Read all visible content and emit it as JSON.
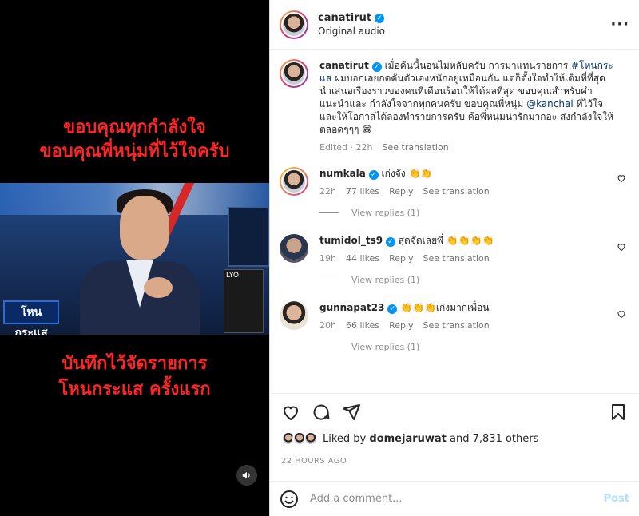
{
  "media": {
    "caption_top": [
      "ขอบคุณทุกกำลังใจ",
      "ขอบคุณพี่หนุ่มที่ไว้ใจครับ"
    ],
    "caption_bottom": [
      "บันทึกไว้จัดรายการ",
      "โหนกระแส ครั้งแรก"
    ],
    "show_logo_text": "โหน กระแส",
    "ad_text": "LYO"
  },
  "header": {
    "username": "canatirut",
    "subtitle": "Original audio"
  },
  "caption": {
    "username": "canatirut",
    "text_1": "เมื่อคืนนี้นอนไม่หลับครับ การมาแทนรายการ ",
    "hashtag": "#โหนกระแส",
    "text_2": " ผมบอกเลยกดดันตัวเองหนักอยู่เหมือนกัน แต่ก็ตั้งใจทำให้เต็มที่ที่สุด นำเสนอเรื่องราวของคนที่เดือนร้อนให้ได้ผลที่สุด ขอบคุณสำหรับคำแนะนำและ กำลังใจจากทุกคนครับ ขอบคุณพี่หนุ่ม ",
    "mention": "@kanchai",
    "text_3": " ที่ไว้ใจและให้โอกาสได้ลองทำรายการครับ คือพี่หนุ่มน่ารักมากอะ ส่งกำลังใจให้ตลอดๆๆๆ 😁",
    "edited": "Edited · 22h",
    "see_translation": "See translation"
  },
  "comments": [
    {
      "username": "numkala",
      "verified": true,
      "text": "เก่งจัง 👏👏",
      "time": "22h",
      "likes": "77 likes",
      "reply": "Reply",
      "translate": "See translation",
      "replies": "View replies (1)"
    },
    {
      "username": "tumidol_ts9",
      "verified": true,
      "text": "สุดจัดเลยพี่ 👏👏👏👏",
      "time": "19h",
      "likes": "44 likes",
      "reply": "Reply",
      "translate": "See translation",
      "replies": "View replies (1)"
    },
    {
      "username": "gunnapat23",
      "verified": true,
      "text": "👏👏👏เก่งมากเพื่อน",
      "time": "20h",
      "likes": "66 likes",
      "reply": "Reply",
      "translate": "See translation",
      "replies": "View replies (1)"
    }
  ],
  "likes": {
    "prefix": "Liked by ",
    "user": "domejaruwat",
    "suffix": " and 7,831 others"
  },
  "timestamp": "22 HOURS AGO",
  "comment_input": {
    "placeholder": "Add a comment..."
  },
  "post_label": "Post",
  "colors": {
    "accent": "#0095f6",
    "caption_red": "#ff2525",
    "post_disabled": "#b2dffc"
  }
}
